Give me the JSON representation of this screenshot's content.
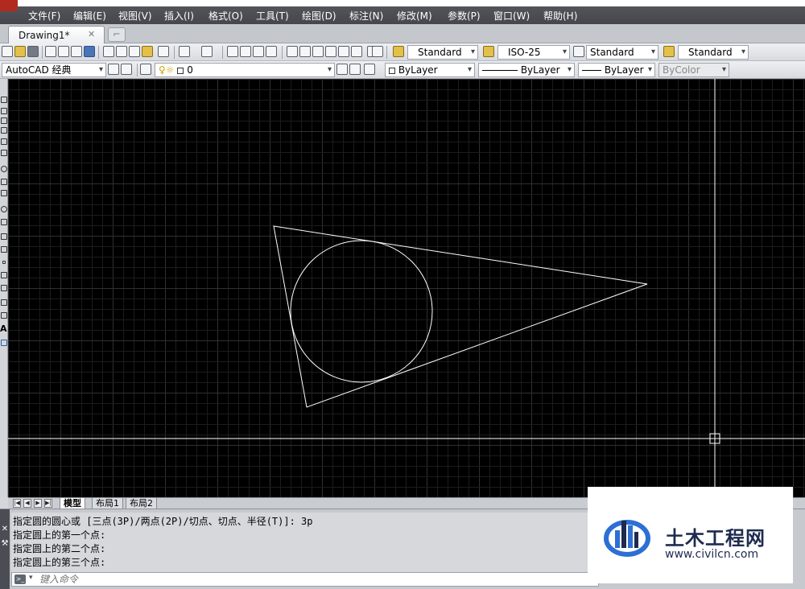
{
  "menubar": {
    "items": [
      "文件(F)",
      "编辑(E)",
      "视图(V)",
      "插入(I)",
      "格式(O)",
      "工具(T)",
      "绘图(D)",
      "标注(N)",
      "修改(M)",
      "参数(P)",
      "窗口(W)",
      "帮助(H)"
    ]
  },
  "tabs": {
    "drawing_label": "Drawing1*",
    "close_glyph": "✕"
  },
  "toolbar1": {
    "text_style": "Standard",
    "dim_style": "ISO-25",
    "table_style": "Standard",
    "mleader_style": "Standard"
  },
  "toolbar2": {
    "workspace": "AutoCAD 经典",
    "layer": "0",
    "color": "ByLayer",
    "linetype": "ByLayer",
    "lineweight": "ByLayer",
    "plotstyle": "ByColor"
  },
  "layout_tabs": {
    "model": "模型",
    "layout1": "布局1",
    "layout2": "布局2"
  },
  "command": {
    "history": [
      "指定圆的圆心或 [三点(3P)/两点(2P)/切点、切点、半径(T)]: 3p",
      "指定圆上的第一个点:",
      "指定圆上的第二个点:",
      "指定圆上的第三个点:"
    ],
    "placeholder": "键入命令"
  },
  "watermark": {
    "title": "土木工程网",
    "url": "www.civilcn.com"
  },
  "colors": {
    "canvas": "#000000",
    "geometry": "#ffffff",
    "grid_minor": "#1c1c1c",
    "grid_major": "#303030",
    "watermark_blue": "#2d6fd4",
    "watermark_navy": "#1e2b4f"
  },
  "icons": {
    "app": "autocad-logo-icon",
    "crosshair": "crosshair-pickbox-icon",
    "cmd_prompt": "command-prompt-icon"
  }
}
